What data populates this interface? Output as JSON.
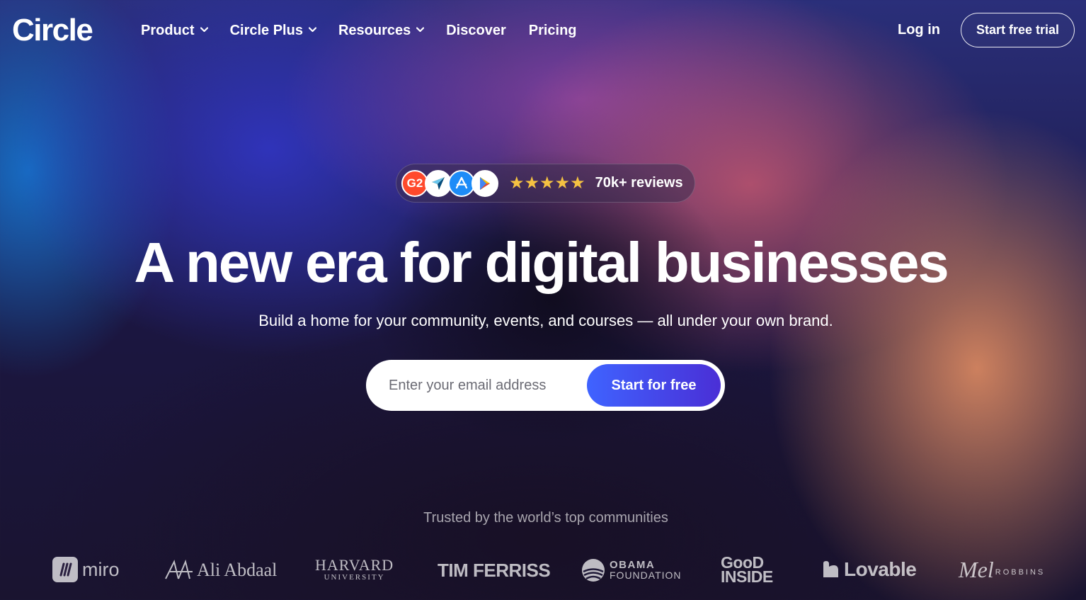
{
  "brand": {
    "logo": "Circle"
  },
  "nav": {
    "items": [
      {
        "label": "Product",
        "has_dropdown": true
      },
      {
        "label": "Circle Plus",
        "has_dropdown": true
      },
      {
        "label": "Resources",
        "has_dropdown": true
      },
      {
        "label": "Discover",
        "has_dropdown": false
      },
      {
        "label": "Pricing",
        "has_dropdown": false
      }
    ],
    "login_label": "Log in",
    "trial_label": "Start free trial"
  },
  "reviews": {
    "badge_icons": [
      "g2-icon",
      "capterra-icon",
      "app-store-icon",
      "google-play-icon"
    ],
    "g2_text": "G2",
    "stars": "★★★★★",
    "rating": 5,
    "label": "70k+ reviews"
  },
  "hero": {
    "headline": "A new era for digital businesses",
    "subheadline": "Build a home for your community, events, and courses — all under your own brand.",
    "email_placeholder": "Enter your email address",
    "email_value": "",
    "cta_label": "Start for free"
  },
  "trusted": {
    "label": "Trusted by the world’s top communities",
    "logos": {
      "miro": "miro",
      "ali": "Ali Abdaal",
      "harvard_main": "HARVARD",
      "harvard_sub": "UNIVERSITY",
      "tim": "TIM FERRISS",
      "obama_main": "OBAMA",
      "obama_sub": "FOUNDATION",
      "good_1": "GooD",
      "good_2": "INSIDE",
      "lovable": "Lovable",
      "mel_script": "Mel",
      "mel_sub": "ROBBINS"
    }
  },
  "colors": {
    "cta_start": "#3f63ff",
    "cta_end": "#4a2fd6",
    "star": "#f5c242",
    "g2_red": "#ff492c"
  }
}
